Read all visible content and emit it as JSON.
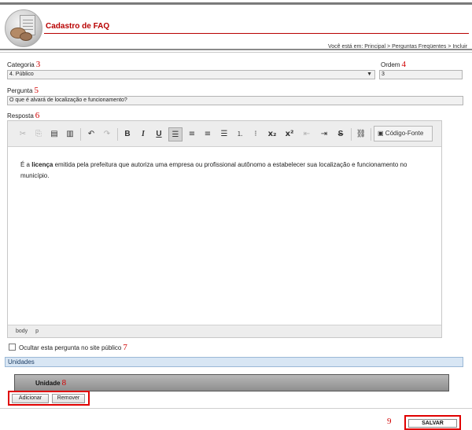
{
  "header": {
    "title": "Cadastro de FAQ",
    "breadcrumb": "Você está em: Principal > Perguntas Freqüentes > Incluir"
  },
  "form": {
    "categoria": {
      "label": "Categoria",
      "marker": "3",
      "value": "4. Público"
    },
    "ordem": {
      "label": "Ordem",
      "marker": "4",
      "value": "3"
    },
    "pergunta": {
      "label": "Pergunta",
      "marker": "5",
      "value": "O que é alvará de localização e funcionamento?"
    },
    "resposta": {
      "label": "Resposta",
      "marker": "6"
    }
  },
  "editor": {
    "toolbar": {
      "source_label": "Código-Fonte",
      "icons": [
        "cut-icon",
        "copy-icon",
        "paste-icon",
        "paste-text-icon",
        "undo-icon",
        "redo-icon",
        "bold-icon",
        "italic-icon",
        "underline-icon",
        "align-left-icon",
        "align-center-icon",
        "align-right-icon",
        "justify-icon",
        "numbered-list-icon",
        "bullet-list-icon",
        "subscript-icon",
        "superscript-icon",
        "outdent-icon",
        "indent-icon",
        "strikethrough-icon",
        "link-icon",
        "source-icon"
      ]
    },
    "content": {
      "prefix": "É a ",
      "bold": "licença",
      "rest": " emitida pela prefeitura que autoriza uma empresa ou profissional autônomo a estabelecer sua localização e funcionamento no município."
    },
    "path": [
      "body",
      "p"
    ]
  },
  "ocultar": {
    "label": "Ocultar esta pergunta no site público",
    "marker": "7",
    "checked": false
  },
  "unidades": {
    "title": "Unidades",
    "column": "Unidade",
    "marker": "8",
    "add_label": "Adicionar",
    "remove_label": "Remover"
  },
  "actions": {
    "save_marker": "9",
    "save_label": "SALVAR"
  },
  "colors": {
    "title_red": "#b80000",
    "marker_red": "#d10000",
    "section_blue": "#d8e6f4"
  }
}
